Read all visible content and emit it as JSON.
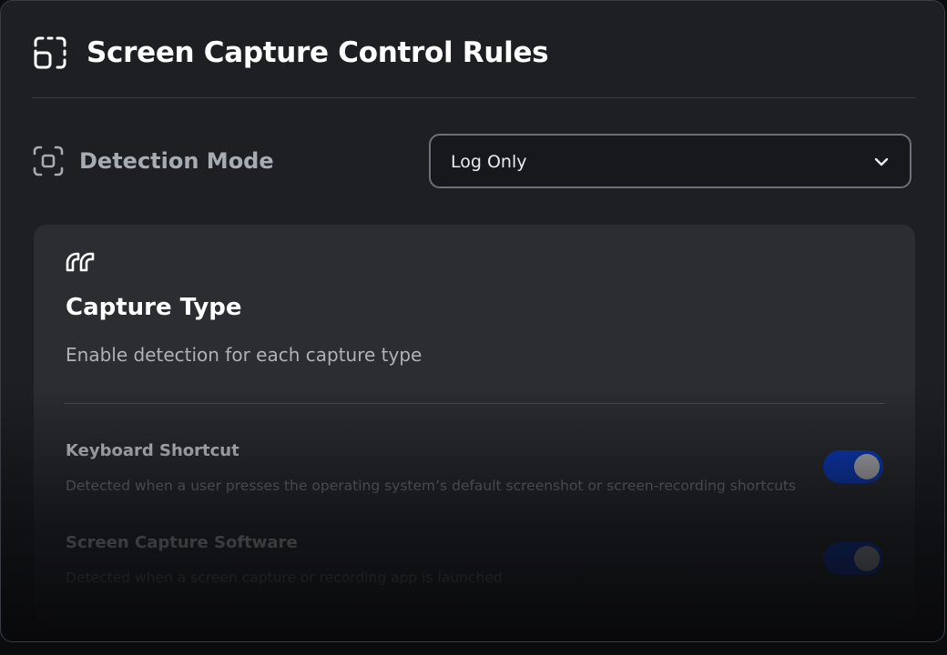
{
  "header": {
    "title": "Screen Capture Control Rules",
    "icon": "screen-capture-icon"
  },
  "detection_mode": {
    "label": "Detection Mode",
    "icon": "capture-target-icon",
    "selected": "Log Only"
  },
  "capture_type": {
    "icon": "quote-icon",
    "title": "Capture Type",
    "subtitle": "Enable detection for each capture type",
    "rules": [
      {
        "title": "Keyboard Shortcut",
        "description": "Detected when a user presses the operating system’s default screenshot or screen-recording shortcuts",
        "enabled": true
      },
      {
        "title": "Screen Capture Software",
        "description": "Detected when a screen capture or recording app is launched",
        "enabled": true
      }
    ]
  },
  "colors": {
    "toggle_on": "#0a3fd6",
    "background": "#1d1f23",
    "card": "#2b2d31"
  }
}
